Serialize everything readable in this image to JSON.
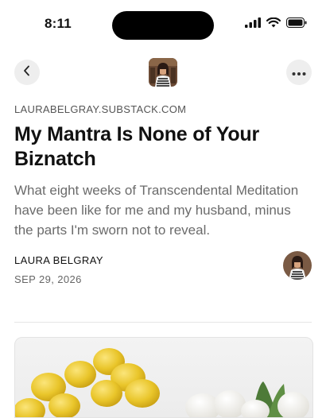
{
  "status_bar": {
    "time": "8:11",
    "icons": [
      "signal-icon",
      "wifi-icon",
      "battery-icon"
    ]
  },
  "nav": {
    "back_icon": "chevron-left-icon",
    "more_icon": "ellipsis-icon"
  },
  "article": {
    "domain": "LAURABELGRAY.SUBSTACK.COM",
    "title": "My Mantra Is None of Your Biznatch",
    "subtitle": "What eight weeks of Transcendental Meditation have been like for me and my husband, minus the parts I'm sworn not to reveal.",
    "author": "LAURA BELGRAY",
    "date": "SEP 29, 2026"
  },
  "colors": {
    "accent_gray": "#eeeeee",
    "text_primary": "#111111",
    "text_secondary": "#6b6b6b",
    "lemon": "#e9c52a",
    "tulip": "#f4f4f0"
  }
}
